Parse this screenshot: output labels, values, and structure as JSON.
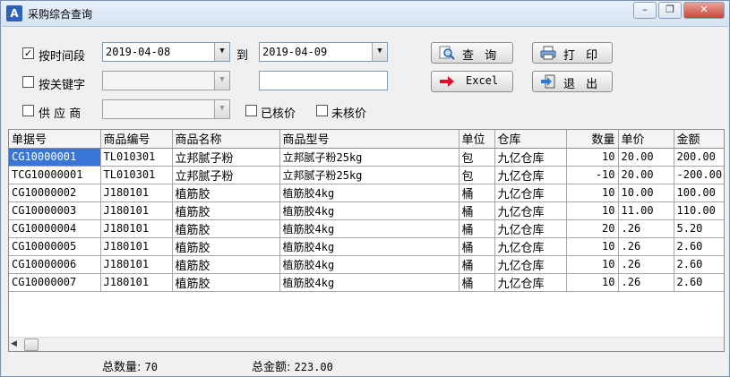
{
  "window": {
    "title": "采购综合查询",
    "app_icon": "app-logo-icon",
    "controls": [
      "minimize-icon",
      "restore-icon",
      "close-icon"
    ]
  },
  "filters": {
    "by_time": {
      "label": "按时间段",
      "checked": true
    },
    "date_from": "2019-04-08",
    "to_label": "到",
    "date_to": "2019-04-09",
    "by_keyword": {
      "label": "按关键字",
      "checked": false
    },
    "keyword_select": "",
    "keyword_text": "",
    "supplier": {
      "label": "供 应 商",
      "checked": false
    },
    "supplier_select": "",
    "priced": {
      "label": "已核价",
      "checked": false
    },
    "unpriced": {
      "label": "未核价",
      "checked": false
    }
  },
  "buttons": {
    "query": "查 询",
    "print": "打 印",
    "excel": "Excel",
    "exit": "退 出"
  },
  "colors": {
    "selection": "#3875d7",
    "excel_arrow": "#e0102a"
  },
  "table": {
    "columns": [
      "单据号",
      "商品编号",
      "商品名称",
      "商品型号",
      "单位",
      "仓库",
      "数量",
      "单价",
      "金额"
    ],
    "rows": [
      [
        "CG10000001",
        "TL010301",
        "立邦腻子粉",
        "立邦腻子粉25kg",
        "包",
        "九亿仓库",
        "10",
        "20.00",
        "200.00"
      ],
      [
        "TCG10000001",
        "TL010301",
        "立邦腻子粉",
        "立邦腻子粉25kg",
        "包",
        "九亿仓库",
        "-10",
        "20.00",
        "-200.00"
      ],
      [
        "CG10000002",
        "J180101",
        "植筋胶",
        "植筋胶4kg",
        "桶",
        "九亿仓库",
        "10",
        "10.00",
        "100.00"
      ],
      [
        "CG10000003",
        "J180101",
        "植筋胶",
        "植筋胶4kg",
        "桶",
        "九亿仓库",
        "10",
        "11.00",
        "110.00"
      ],
      [
        "CG10000004",
        "J180101",
        "植筋胶",
        "植筋胶4kg",
        "桶",
        "九亿仓库",
        "20",
        ".26",
        "5.20"
      ],
      [
        "CG10000005",
        "J180101",
        "植筋胶",
        "植筋胶4kg",
        "桶",
        "九亿仓库",
        "10",
        ".26",
        "2.60"
      ],
      [
        "CG10000006",
        "J180101",
        "植筋胶",
        "植筋胶4kg",
        "桶",
        "九亿仓库",
        "10",
        ".26",
        "2.60"
      ],
      [
        "CG10000007",
        "J180101",
        "植筋胶",
        "植筋胶4kg",
        "桶",
        "九亿仓库",
        "10",
        ".26",
        "2.60"
      ]
    ]
  },
  "summary": {
    "total_qty_label": "总数量:",
    "total_qty": "70",
    "total_amount_label": "总金额:",
    "total_amount": "223.00"
  }
}
